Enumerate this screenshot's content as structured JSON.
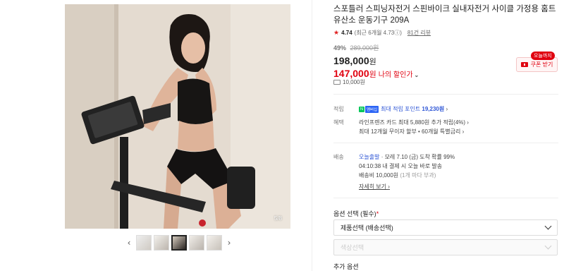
{
  "gallery": {
    "counter": "5/8",
    "prev_icon": "chevron-left-icon",
    "next_icon": "chevron-right-icon",
    "thumbnails": 5,
    "active_index": 2
  },
  "product": {
    "title": "스포틀러 스피닝자전거 스핀바이크 실내자전거 사이클 가정용 홈트 유산소 운동기구 209A",
    "rating": "4.74",
    "rating_detail": "(최근 6개월 4.73ⓘ)",
    "reviews": "81건 리뷰",
    "discount_pct": "49%",
    "original_price": "289,000원",
    "price": "198,000",
    "my_price": "147,000",
    "currency": "원",
    "my_price_label": "나의 할인가",
    "coupon_badge": "오늘까지",
    "coupon_button": "쿠폰 받기",
    "shipping_fee_top": "10,000원"
  },
  "details": {
    "points_label": "적립",
    "npay_badge": "N",
    "npay_badge2": "멤버십",
    "points_text": "최대 적립 포인트",
    "points_value": "19,230원",
    "benefit_label": "혜택",
    "benefit_line1": "라인프렌즈 카드 최대 5,880원 추가 적립(4%)",
    "benefit_line2": "최대 12개월 무이자 할부 • 60개월 특별금리",
    "delivery_label": "배송",
    "delivery_type": "오늘출발",
    "delivery_line1": "· 모레 7.10 (금) 도착 확률 99%",
    "delivery_line2": "04:10:38  내 결제 시 오늘 바로 발송",
    "delivery_fee": "배송비 10,000원",
    "delivery_fee_note": "(1개 마다 부과)",
    "more_link": "자세히 보기"
  },
  "options": {
    "label": "옵션 선택 (필수)",
    "required_mark": "*",
    "select1": "제품선택 (배송선택)",
    "select2": "색상선택",
    "extra_label": "추가 옵션"
  },
  "colors": {
    "accent_red": "#e0000f",
    "link_blue": "#2e56d6"
  }
}
